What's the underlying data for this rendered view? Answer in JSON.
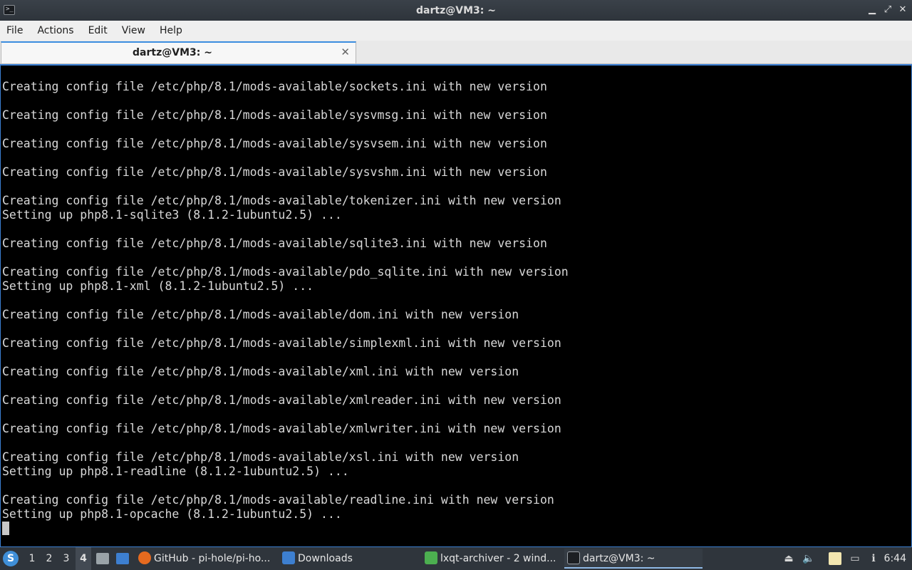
{
  "window": {
    "title": "dartz@VM3: ~",
    "icon": "terminal-icon",
    "controls": {
      "minimize": "▁",
      "restore": "⤢",
      "close": "✕"
    }
  },
  "menu": [
    "File",
    "Actions",
    "Edit",
    "View",
    "Help"
  ],
  "tab": {
    "label": "dartz@VM3: ~",
    "close": "✕"
  },
  "terminal": {
    "lines": [
      "Creating config file /etc/php/8.1/mods-available/sockets.ini with new version",
      "",
      "Creating config file /etc/php/8.1/mods-available/sysvmsg.ini with new version",
      "",
      "Creating config file /etc/php/8.1/mods-available/sysvsem.ini with new version",
      "",
      "Creating config file /etc/php/8.1/mods-available/sysvshm.ini with new version",
      "",
      "Creating config file /etc/php/8.1/mods-available/tokenizer.ini with new version",
      "Setting up php8.1-sqlite3 (8.1.2-1ubuntu2.5) ...",
      "",
      "Creating config file /etc/php/8.1/mods-available/sqlite3.ini with new version",
      "",
      "Creating config file /etc/php/8.1/mods-available/pdo_sqlite.ini with new version",
      "Setting up php8.1-xml (8.1.2-1ubuntu2.5) ...",
      "",
      "Creating config file /etc/php/8.1/mods-available/dom.ini with new version",
      "",
      "Creating config file /etc/php/8.1/mods-available/simplexml.ini with new version",
      "",
      "Creating config file /etc/php/8.1/mods-available/xml.ini with new version",
      "",
      "Creating config file /etc/php/8.1/mods-available/xmlreader.ini with new version",
      "",
      "Creating config file /etc/php/8.1/mods-available/xmlwriter.ini with new version",
      "",
      "Creating config file /etc/php/8.1/mods-available/xsl.ini with new version",
      "Setting up php8.1-readline (8.1.2-1ubuntu2.5) ...",
      "",
      "Creating config file /etc/php/8.1/mods-available/readline.ini with new version",
      "Setting up php8.1-opcache (8.1.2-1ubuntu2.5) ..."
    ]
  },
  "taskbar": {
    "start_icon": "start-menu-icon",
    "desktops": [
      "1",
      "2",
      "3",
      "4"
    ],
    "active_desktop": "4",
    "quicklaunch": [
      "file-manager-icon",
      "show-desktop-icon"
    ],
    "tasks": [
      {
        "label": "GitHub - pi-hole/pi-ho...",
        "icon": "firefox-icon",
        "color": "#e66a1f"
      },
      {
        "label": "Downloads",
        "icon": "folder-icon",
        "color": "#3d7fd0"
      },
      {
        "label": "lxqt-archiver - 2 wind...",
        "icon": "archiver-icon",
        "color": "#4caf50"
      },
      {
        "label": "dartz@VM3: ~",
        "icon": "terminal-icon",
        "color": "#1c1f23"
      }
    ],
    "tray": [
      "eject-icon",
      "volume-icon",
      "clipboard-icon",
      "network-icon",
      "notification-icon"
    ],
    "clock": "6:44"
  },
  "colors": {
    "accent": "#3b7fd3",
    "terminal_bg": "#000000",
    "terminal_fg": "#d8d8d8"
  }
}
